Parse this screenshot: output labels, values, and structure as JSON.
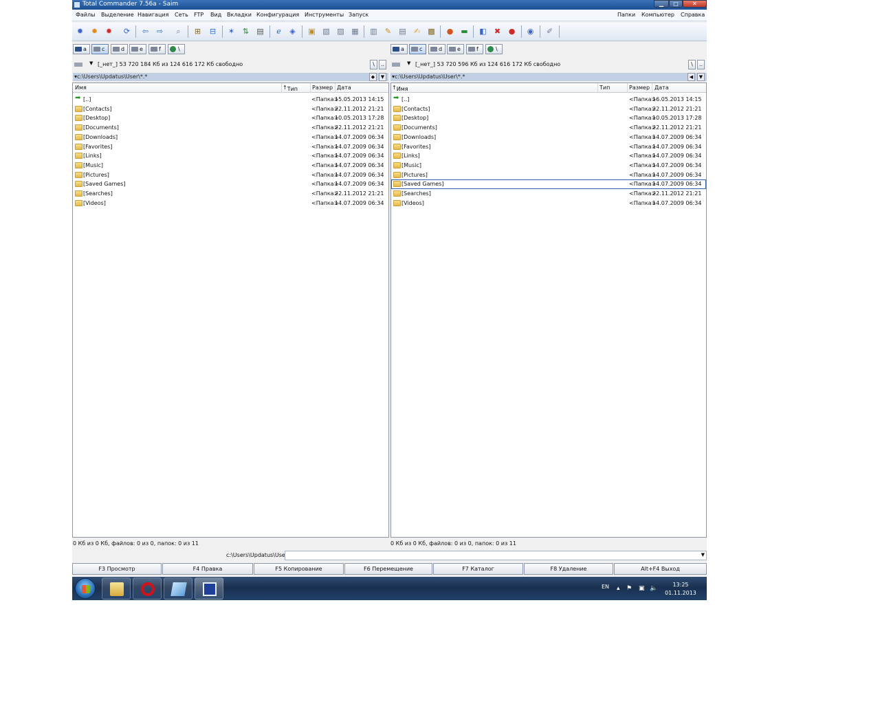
{
  "window": {
    "title": "Total Commander 7.56a - Saim"
  },
  "menu": {
    "left": [
      "Файлы",
      "Выделение",
      "Навигация",
      "Сеть",
      "FTP",
      "Вид",
      "Вкладки",
      "Конфигурация",
      "Инструменты",
      "Запуск"
    ],
    "right": [
      "Папки",
      "Компьютер",
      "Справка"
    ]
  },
  "toolbar_icons": [
    "settings-gear-blue-icon",
    "settings-gear-orange-icon",
    "settings-gear-red-icon",
    "refresh-icon",
    "back-arrow-icon",
    "forward-arrow-icon",
    "search-icon",
    "tree-view-icon",
    "tree-view-panel-icon",
    "wand-icon",
    "compare-icon",
    "clipboard-icon",
    "internet-explorer-icon",
    "network-icon",
    "pack-icon",
    "unpack-icon",
    "compare-files-icon",
    "sync-dirs-icon",
    "lister-icon",
    "multirename-icon",
    "copy-names-icon",
    "edit-icon",
    "attributes-icon",
    "firefox-icon",
    "ftp-connect-icon",
    "tool-a-icon",
    "tool-b-icon",
    "tool-c-icon",
    "tool-d-icon",
    "tool-e-icon"
  ],
  "left_panel": {
    "drives": [
      "a",
      "c",
      "d",
      "e",
      "f",
      "\\"
    ],
    "drive_current": "c",
    "volume": "[_нет_]",
    "free_info": "53 720 184 Кб из 124 616 172 Кб свободно",
    "mini_buttons": [
      "\\",
      ".."
    ],
    "path": "c:\\Users\\Updatus\\User\\*.*",
    "columns": {
      "name": "Имя",
      "type": "Тип",
      "size": "Размер",
      "date": "Дата"
    },
    "rows": [
      {
        "name": "[..]",
        "size": "<Папка>",
        "date": "15.05.2013 14:15",
        "up": true
      },
      {
        "name": "[Contacts]",
        "size": "<Папка>",
        "date": "22.11.2012 21:21"
      },
      {
        "name": "[Desktop]",
        "size": "<Папка>",
        "date": "10.05.2013 17:28"
      },
      {
        "name": "[Documents]",
        "size": "<Папка>",
        "date": "22.11.2012 21:21"
      },
      {
        "name": "[Downloads]",
        "size": "<Папка>",
        "date": "14.07.2009 06:34"
      },
      {
        "name": "[Favorites]",
        "size": "<Папка>",
        "date": "14.07.2009 06:34"
      },
      {
        "name": "[Links]",
        "size": "<Папка>",
        "date": "14.07.2009 06:34"
      },
      {
        "name": "[Music]",
        "size": "<Папка>",
        "date": "14.07.2009 06:34"
      },
      {
        "name": "[Pictures]",
        "size": "<Папка>",
        "date": "14.07.2009 06:34"
      },
      {
        "name": "[Saved Games]",
        "size": "<Папка>",
        "date": "14.07.2009 06:34"
      },
      {
        "name": "[Searches]",
        "size": "<Папка>",
        "date": "22.11.2012 21:21"
      },
      {
        "name": "[Videos]",
        "size": "<Папка>",
        "date": "14.07.2009 06:34"
      }
    ],
    "status": "0 Кб из 0 Кб, файлов: 0 из 0, папок: 0 из 11"
  },
  "right_panel": {
    "drives": [
      "a",
      "c",
      "d",
      "e",
      "f",
      "\\"
    ],
    "drive_current": "c",
    "volume": "[_нет_]",
    "free_info": "53 720 596 Кб из 124 616 172 Кб свободно",
    "mini_buttons": [
      "\\",
      ".."
    ],
    "path": "c:\\Users\\Updatus\\User\\*.*",
    "columns": {
      "name": "Имя",
      "type": "Тип",
      "size": "Размер",
      "date": "Дата"
    },
    "rows": [
      {
        "name": "[..]",
        "size": "<Папка>",
        "date": "16.05.2013 14:15",
        "up": true
      },
      {
        "name": "[Contacts]",
        "size": "<Папка>",
        "date": "22.11.2012 21:21"
      },
      {
        "name": "[Desktop]",
        "size": "<Папка>",
        "date": "10.05.2013 17:28"
      },
      {
        "name": "[Documents]",
        "size": "<Папка>",
        "date": "22.11.2012 21:21"
      },
      {
        "name": "[Downloads]",
        "size": "<Папка>",
        "date": "14.07.2009 06:34"
      },
      {
        "name": "[Favorites]",
        "size": "<Папка>",
        "date": "14.07.2009 06:34"
      },
      {
        "name": "[Links]",
        "size": "<Папка>",
        "date": "14.07.2009 06:34"
      },
      {
        "name": "[Music]",
        "size": "<Папка>",
        "date": "14.07.2009 06:34"
      },
      {
        "name": "[Pictures]",
        "size": "<Папка>",
        "date": "14.07.2009 06:34"
      },
      {
        "name": "[Saved Games]",
        "size": "<Папка>",
        "date": "14.07.2009 06:34",
        "focused": true
      },
      {
        "name": "[Searches]",
        "size": "<Папка>",
        "date": "22.11.2012 21:21"
      },
      {
        "name": "[Videos]",
        "size": "<Папка>",
        "date": "14.07.2009 06:34"
      }
    ],
    "status": "0 Кб из 0 Кб, файлов: 0 из 0, папок: 0 из 11"
  },
  "command_line": {
    "path": "c:\\Users\\Updatus\\User>"
  },
  "function_keys": [
    "F3 Просмотр",
    "F4 Правка",
    "F5 Копирование",
    "F6 Перемещение",
    "F7 Каталог",
    "F8 Удаление",
    "Alt+F4 Выход"
  ],
  "taskbar": {
    "apps": [
      "explorer-icon",
      "opera-icon",
      "notes-icon",
      "total-commander-icon"
    ],
    "language": "EN",
    "time": "13:25",
    "date": "01.11.2013"
  }
}
